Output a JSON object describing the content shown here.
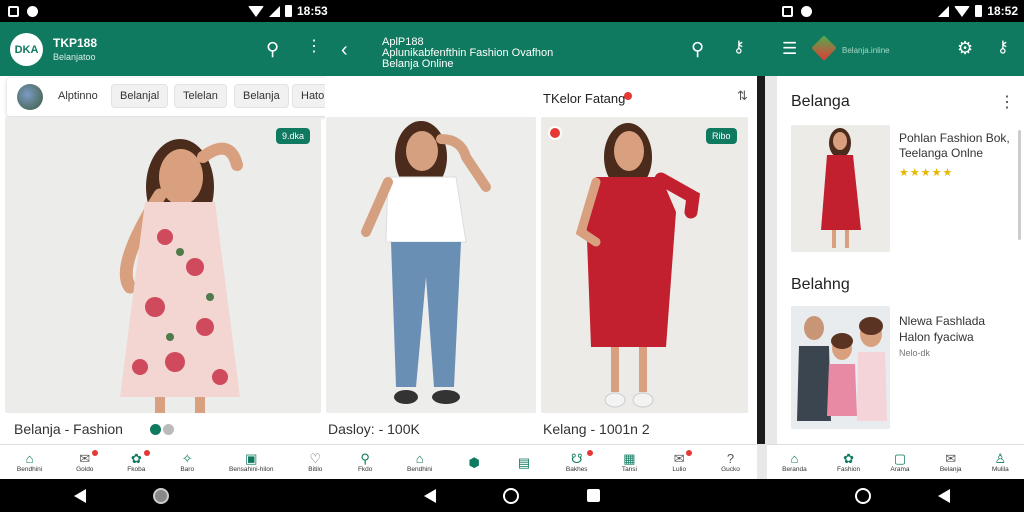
{
  "status_bar": {
    "left_time": "18:53",
    "right_time": "18:52"
  },
  "panel1": {
    "logo_text": "DKA",
    "title": "TKP188",
    "subtitle": "Belanjatoo",
    "chips": [
      "Alptinno",
      "Belanjal",
      "Telelan",
      "Belanja",
      "Hato"
    ],
    "sale_badge": "9.dka",
    "caption": "Belanja - Fashion"
  },
  "panel2": {
    "title_line1": "AplP188",
    "title_line2": "Aplunikabfenfthin Fashion Ovafhon",
    "title_line3": "Belanja Online",
    "caption": "Dasloy: - 100K"
  },
  "panel3": {
    "header_title": "TKelor Fatang",
    "sale_badge": "Ribo",
    "caption": "Kelang - 1001n 2"
  },
  "panel4": {
    "brand_line": "Belanja.inline",
    "section1_title": "Belanga",
    "card1_title": "Pohlan Fashion Bok, Teelanga Onlne",
    "card1_stars": "★★★★★",
    "section2_title": "Belahng",
    "card2_title": "Nlewa Fashlada Halon fyaciwa",
    "card2_meta": "Nelo-dk"
  },
  "bottom_nav_left": [
    {
      "icon": "home-icon",
      "label": "Bendhini",
      "glyph": "⌂",
      "badge": false
    },
    {
      "icon": "bell-icon",
      "label": "Goldo",
      "glyph": "✉",
      "badge": true
    },
    {
      "icon": "promo-icon",
      "label": "Fkoba",
      "glyph": "✿",
      "badge": true
    },
    {
      "icon": "alert-icon",
      "label": "Baro",
      "glyph": "✧",
      "badge": false
    },
    {
      "icon": "cart-icon",
      "label": "Bensahini-hilon",
      "glyph": "▣",
      "badge": false
    },
    {
      "icon": "heart-icon",
      "label": "Bitilo",
      "glyph": "♡",
      "badge": false
    },
    {
      "icon": "location-icon",
      "label": "Fkdo",
      "glyph": "⚲",
      "badge": false
    },
    {
      "icon": "home-icon",
      "label": "Bendhini",
      "glyph": "⌂",
      "badge": false
    },
    {
      "icon": "map-pin-icon",
      "label": "",
      "glyph": "⬢",
      "badge": false
    },
    {
      "icon": "shop-icon",
      "label": "",
      "glyph": "▤",
      "badge": false
    },
    {
      "icon": "bag-icon",
      "label": "Bakhes",
      "glyph": "☋",
      "badge": true
    },
    {
      "icon": "chat-icon",
      "label": "Tansi",
      "glyph": "▦",
      "badge": false
    },
    {
      "icon": "inbox-icon",
      "label": "Lulio",
      "glyph": "✉",
      "badge": true
    },
    {
      "icon": "help-icon",
      "label": "Gucko",
      "glyph": "?",
      "badge": false
    }
  ],
  "bottom_nav_right": [
    {
      "icon": "home-icon",
      "label": "Beranda",
      "glyph": "⌂"
    },
    {
      "icon": "favorite-icon",
      "label": "Fashion",
      "glyph": "✿"
    },
    {
      "icon": "bag-icon",
      "label": "Arama",
      "glyph": "▢"
    },
    {
      "icon": "chat-icon",
      "label": "Belanja",
      "glyph": "✉"
    },
    {
      "icon": "profile-icon",
      "label": "Mulila",
      "glyph": "♙"
    }
  ],
  "colors": {
    "accent": "#0f7a5f",
    "badge": "#e53935"
  }
}
